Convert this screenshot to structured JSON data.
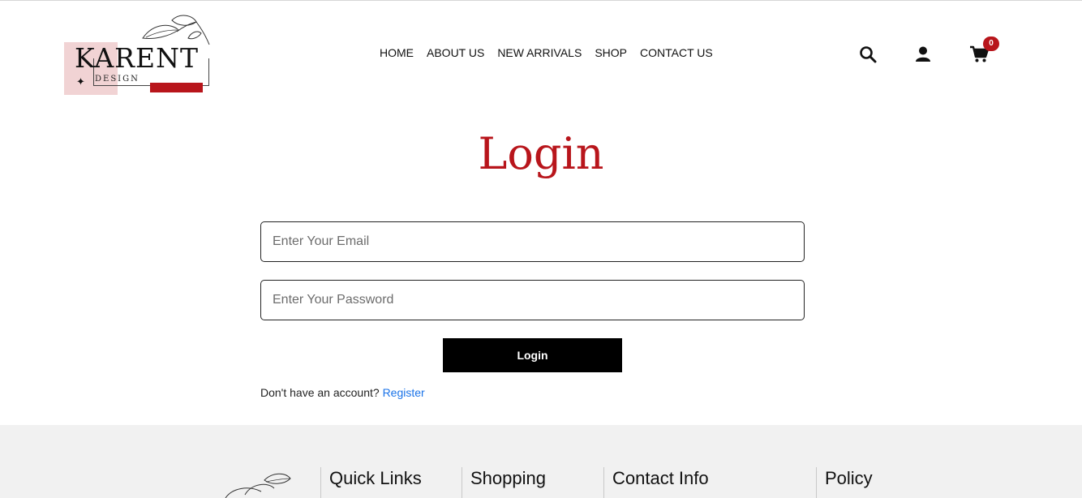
{
  "brand": {
    "name": "KARENT",
    "sub": "DESIGN"
  },
  "nav": {
    "items": [
      "HOME",
      "ABOUT US",
      "NEW ARRIVALS",
      "SHOP",
      "CONTACT US"
    ]
  },
  "header_icons": {
    "search": "search-icon",
    "account": "user-icon",
    "cart": "cart-icon",
    "cart_count": "0"
  },
  "login": {
    "title": "Login",
    "email_placeholder": "Enter Your Email",
    "password_placeholder": "Enter Your Password",
    "button_label": "Login",
    "no_account_text": "Don't have an account?",
    "register_link": "Register"
  },
  "footer": {
    "columns": [
      "Quick Links",
      "Shopping",
      "Contact Info",
      "Policy"
    ]
  },
  "colors": {
    "accent": "#b8151b",
    "link": "#1a73e8",
    "footer_bg": "#f1f1f1",
    "logo_pink": "#f1d3d4"
  }
}
